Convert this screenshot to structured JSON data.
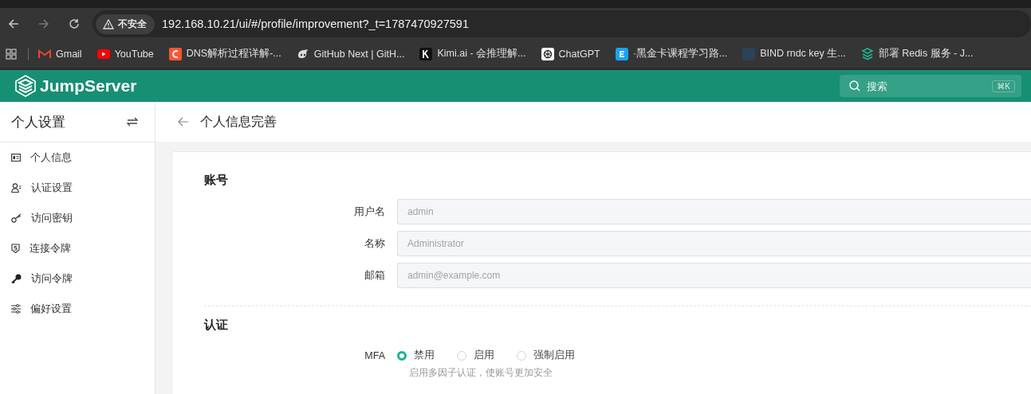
{
  "browser": {
    "security_label": "不安全",
    "url": "192.168.10.21/ui/#/profile/improvement?_t=1787470927591",
    "bookmarks": [
      {
        "label": "Gmail"
      },
      {
        "label": "YouTube"
      },
      {
        "label": "DNS解析过程详解-..."
      },
      {
        "label": "GitHub Next | GitH..."
      },
      {
        "label": "Kimi.ai - 会推理解..."
      },
      {
        "label": "ChatGPT"
      },
      {
        "label": "·黑金卡课程学习路..."
      },
      {
        "label": "BIND rndc key 生..."
      },
      {
        "label": "部署 Redis 服务 - J..."
      }
    ]
  },
  "header": {
    "logo": "JumpServer",
    "search": {
      "placeholder": "搜索",
      "shortcut": "⌘K"
    }
  },
  "sidebar": {
    "title": "个人设置",
    "items": [
      {
        "label": "个人信息",
        "selected": false
      },
      {
        "label": "认证设置",
        "selected": false
      },
      {
        "label": "访问密钥",
        "selected": false
      },
      {
        "label": "连接令牌",
        "selected": false
      },
      {
        "label": "访问令牌",
        "selected": false
      },
      {
        "label": "偏好设置",
        "selected": false
      }
    ]
  },
  "page": {
    "title": "个人信息完善",
    "sections": [
      {
        "title": "账号",
        "fields": [
          {
            "kind": "input",
            "label": "用户名",
            "value": "admin",
            "disabled": true
          },
          {
            "kind": "input",
            "label": "名称",
            "value": "Administrator",
            "disabled": true
          },
          {
            "kind": "input",
            "label": "邮箱",
            "value": "admin@example.com",
            "disabled": true
          }
        ]
      },
      {
        "title": "认证",
        "fields": [
          {
            "kind": "radio",
            "label": "MFA",
            "options": [
              {
                "label": "禁用",
                "selected": true
              },
              {
                "label": "启用",
                "selected": false
              },
              {
                "label": "强制启用",
                "selected": false
              }
            ],
            "hint": "启用多因子认证，使账号更加安全"
          }
        ]
      }
    ]
  }
}
